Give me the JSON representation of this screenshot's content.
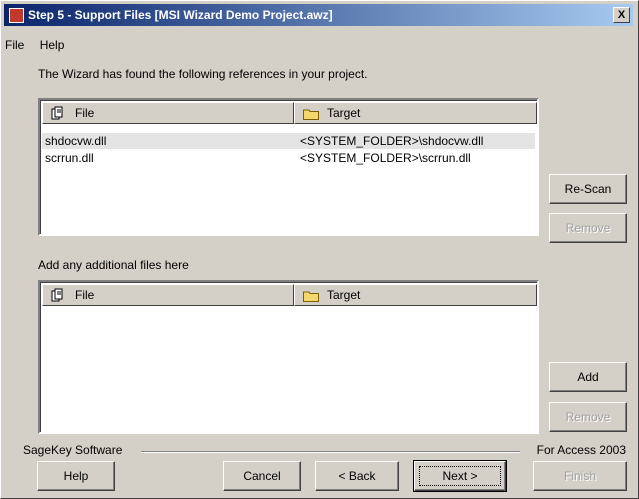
{
  "window": {
    "title": "Step 5 - Support Files [MSI Wizard Demo Project.awz]",
    "close_label": "X"
  },
  "menu": {
    "items": [
      "File",
      "Help"
    ]
  },
  "intro_text": "The Wizard has found the following references in your project.",
  "references_list": {
    "columns": [
      "File",
      "Target"
    ],
    "rows": [
      {
        "file": "shdocvw.dll",
        "target": "<SYSTEM_FOLDER>\\shdocvw.dll"
      },
      {
        "file": "scrrun.dll",
        "target": "<SYSTEM_FOLDER>\\scrrun.dll"
      }
    ]
  },
  "additional_label": "Add any additional files here",
  "additional_list": {
    "columns": [
      "File",
      "Target"
    ]
  },
  "buttons": {
    "rescan": "Re-Scan",
    "remove_top": "Remove",
    "add": "Add",
    "remove_bottom": "Remove",
    "help": "Help",
    "cancel": "Cancel",
    "back": "< Back",
    "next": "Next >",
    "finish": "Finish"
  },
  "footer": {
    "company": "SageKey Software",
    "product": "For Access 2003"
  }
}
